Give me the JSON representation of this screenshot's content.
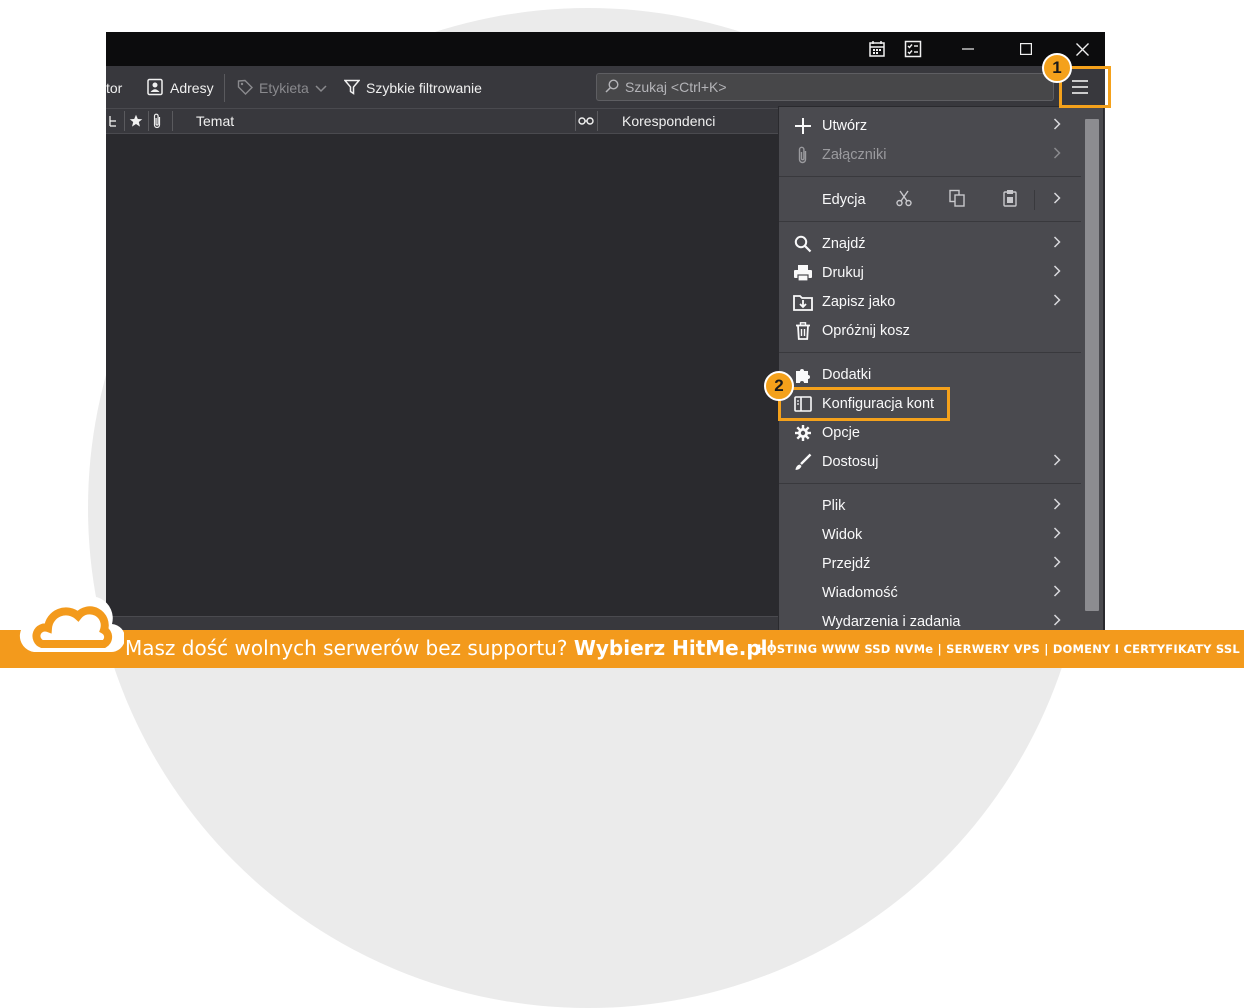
{
  "toolbar": {
    "partial_label": "tor",
    "address_book_label": "Adresy",
    "tag_label": "Etykieta",
    "quick_filter_label": "Szybkie filtrowanie",
    "search_placeholder": "Szukaj <Ctrl+K>"
  },
  "columns": {
    "subject": "Temat",
    "correspondents": "Korespondenci"
  },
  "menu": {
    "new": "Utwórz",
    "attachments": "Załączniki",
    "edit": "Edycja",
    "find": "Znajdź",
    "print": "Drukuj",
    "save_as": "Zapisz jako",
    "empty_trash": "Opróżnij kosz",
    "addons": "Dodatki",
    "account_settings": "Konfiguracja kont",
    "options": "Opcje",
    "customize": "Dostosuj",
    "file": "Plik",
    "view": "Widok",
    "go": "Przejdź",
    "message": "Wiadomość",
    "events_tasks": "Wydarzenia i zadania"
  },
  "badges": {
    "step1": "1",
    "step2": "2"
  },
  "banner": {
    "text_normal": "Masz dość wolnych serwerów bez supportu? ",
    "text_bold": "Wybierz HitMe.pl",
    "text_end": "!",
    "right_text": "HOSTING WWW SSD NVMe | SERWERY VPS | DOMENY I CERTYFIKATY SSL"
  },
  "colors": {
    "accent": "#f4a11b",
    "banner": "#f39a1c",
    "menu_bg": "#4a4a4f",
    "window_bg": "#2a2a2e"
  },
  "icons": {
    "calendar": "calendar-icon",
    "tasks": "tasks-icon",
    "hamburger": "hamburger-menu-icon"
  }
}
